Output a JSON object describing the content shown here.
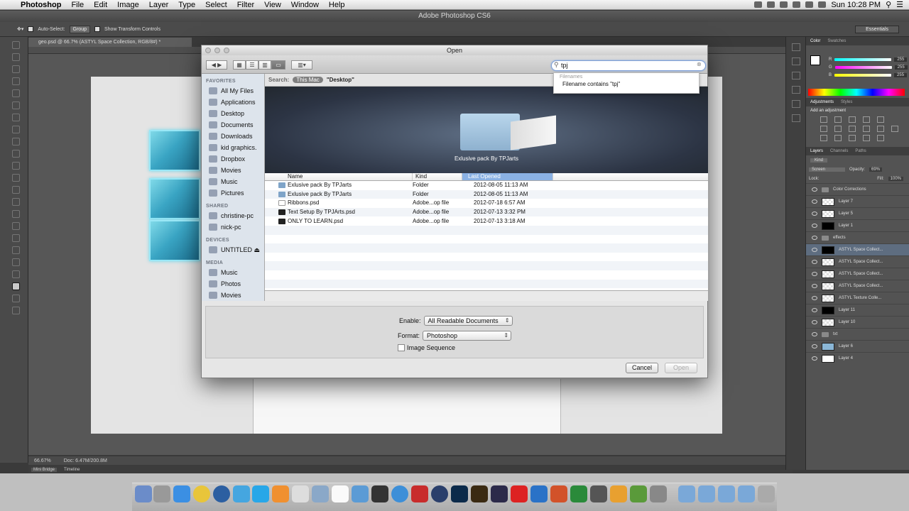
{
  "menubar": {
    "app": "Photoshop",
    "items": [
      "File",
      "Edit",
      "Image",
      "Layer",
      "Type",
      "Select",
      "Filter",
      "View",
      "Window",
      "Help"
    ],
    "clock": "Sun 10:28 PM"
  },
  "window_title": "Adobe Photoshop CS6",
  "options": {
    "auto_select": "Auto-Select:",
    "group": "Group",
    "show_transform": "Show Transform Controls",
    "workspace": "Essentials"
  },
  "doc_tab": "geo.psd @ 66.7% (ASTYL Space Collection, RGB/8#) *",
  "status": {
    "zoom": "66.67%",
    "doc": "Doc: 6.47M/200.8M"
  },
  "bottom_tabs": [
    "Mini Bridge",
    "Timeline"
  ],
  "color_panel": {
    "tabs": [
      "Color",
      "Swatches"
    ],
    "channels": [
      {
        "label": "R",
        "value": "255"
      },
      {
        "label": "G",
        "value": "255"
      },
      {
        "label": "B",
        "value": "255"
      }
    ]
  },
  "adjust_panel": {
    "tabs": [
      "Adjustments",
      "Styles"
    ],
    "title": "Add an adjustment"
  },
  "layers_panel": {
    "tabs": [
      "Layers",
      "Channels",
      "Paths"
    ],
    "kind": "Kind",
    "blend": "Screen",
    "opacity_label": "Opacity:",
    "opacity": "69%",
    "lock_label": "Lock:",
    "fill_label": "Fill:",
    "fill": "100%",
    "layers": [
      {
        "name": "Color Corrections",
        "type": "group"
      },
      {
        "name": "Layer 7",
        "type": "check"
      },
      {
        "name": "Layer 5",
        "type": "check"
      },
      {
        "name": "Layer 1",
        "type": "black"
      },
      {
        "name": "effects",
        "type": "group"
      },
      {
        "name": "ASTYL Space Collect...",
        "type": "black",
        "selected": true
      },
      {
        "name": "ASTYL Space Collect...",
        "type": "check"
      },
      {
        "name": "ASTYL Space Collect...",
        "type": "check"
      },
      {
        "name": "ASTYL Space Collect...",
        "type": "check"
      },
      {
        "name": "ASTYL Texture Colle...",
        "type": "check"
      },
      {
        "name": "Layer 11",
        "type": "black"
      },
      {
        "name": "Layer 10",
        "type": "check"
      },
      {
        "name": "txt",
        "type": "group"
      },
      {
        "name": "Layer 6",
        "type": "blue"
      },
      {
        "name": "Layer 4",
        "type": "white"
      }
    ]
  },
  "dialog": {
    "title": "Open",
    "search_value": "tpj",
    "suggest_header": "Filenames",
    "suggest_item": "Filename contains \"tpj\"",
    "scope_label": "Search:",
    "scope_this_mac": "This Mac",
    "scope_desktop": "\"Desktop\"",
    "favorites_header": "FAVORITES",
    "favorites": [
      "All My Files",
      "Applications",
      "Desktop",
      "Documents",
      "Downloads",
      "kid graphics.",
      "Dropbox",
      "Movies",
      "Music",
      "Pictures"
    ],
    "shared_header": "SHARED",
    "shared": [
      "christine-pc",
      "nick-pc"
    ],
    "devices_header": "DEVICES",
    "devices": [
      "UNTITLED ⏏"
    ],
    "media_header": "MEDIA",
    "media": [
      "Music",
      "Photos",
      "Movies"
    ],
    "preview_name": "Exlusive pack By TPJarts",
    "columns": {
      "name": "Name",
      "kind": "Kind",
      "date": "Last Opened"
    },
    "files": [
      {
        "name": "Exlusive pack By TPJarts",
        "kind": "Folder",
        "date": "2012-08-05 11:13 AM",
        "icon": "folder"
      },
      {
        "name": "Exlusive pack By TPJarts",
        "kind": "Folder",
        "date": "2012-08-05 11:13 AM",
        "icon": "folder"
      },
      {
        "name": "Ribbons.psd",
        "kind": "Adobe...op file",
        "date": "2012-07-18 6:57 AM",
        "icon": "doc"
      },
      {
        "name": "Text Setup By TPJArts.psd",
        "kind": "Adobe...op file",
        "date": "2012-07-13 3:32 PM",
        "icon": "dark"
      },
      {
        "name": "ONLY TO LEARN.psd",
        "kind": "Adobe...op file",
        "date": "2012-07-13 3:18 AM",
        "icon": "dark"
      }
    ],
    "enable_label": "Enable:",
    "enable_value": "All Readable Documents",
    "format_label": "Format:",
    "format_value": "Photoshop",
    "sequence_label": "Image Sequence",
    "cancel": "Cancel",
    "open": "Open"
  }
}
